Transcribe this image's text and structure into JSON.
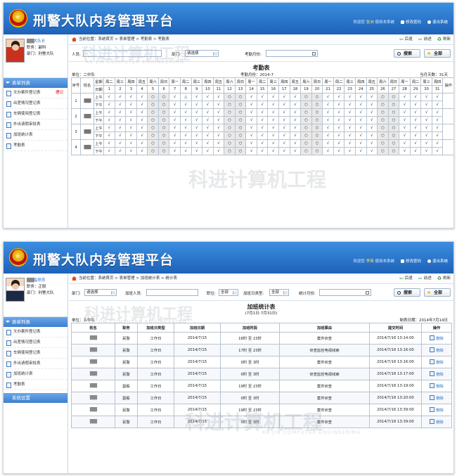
{
  "app": {
    "title": "刑警大队内务管理平台",
    "welcome_prefix": "欢迎您",
    "welcome_suffix": "使用本系统",
    "change_password": "修改密码",
    "logout": "退出系统"
  },
  "nav": {
    "back": "后退",
    "forward": "前进",
    "refresh": "刷新"
  },
  "sidebar": {
    "menu_header": "表单列表",
    "items": [
      "文办案件登记表",
      "出差情况登记表",
      "车辆使用登记表",
      "外出请假审批表",
      "加班统计表",
      "考勤表"
    ],
    "badge": "理记",
    "system_settings": "系统设置"
  },
  "screen1": {
    "user": {
      "name": "大队长",
      "post_label": "职务：",
      "post": "副科",
      "dept_label": "部门：",
      "dept": "刑警大队"
    },
    "welcome_name": "张洲",
    "breadcrumb": "当前位置：系统首页 > 表单管理 > 考勤表 > 考勤表",
    "filter": {
      "person_label": "人员:",
      "dept_label": "部门:",
      "dept_value": "请选择",
      "month_label": "考勤月份:"
    },
    "search_button": "搜索",
    "all_button": "全部",
    "table_title": "考勤表",
    "unit_label": "单位：二中队",
    "month_label": "考勤月份：2014-7",
    "days_label": "当月天数：31天",
    "header_seq": "序号",
    "header_name": "姓名",
    "header_week": "星期",
    "header_date": "日期",
    "header_op": "操作",
    "weekdays": [
      "周二",
      "周三",
      "周四",
      "周五",
      "周六",
      "周日",
      "周一",
      "周二",
      "周三",
      "周四",
      "周五",
      "周六",
      "周日",
      "周一",
      "周二",
      "周三",
      "周四",
      "周五",
      "周六",
      "周日",
      "周一",
      "周二",
      "周三",
      "周四",
      "周五",
      "周六",
      "周日",
      "周一",
      "周二",
      "周三",
      "周四"
    ],
    "dates": [
      "1",
      "2",
      "3",
      "4",
      "5",
      "6",
      "7",
      "8",
      "9",
      "10",
      "11",
      "12",
      "13",
      "14",
      "15",
      "16",
      "17",
      "18",
      "19",
      "20",
      "21",
      "22",
      "23",
      "24",
      "25",
      "26",
      "27",
      "28",
      "29",
      "30",
      "31"
    ],
    "am": "上午",
    "pm": "下午",
    "rows": [
      {
        "seq": "1",
        "name": "███",
        "am": [
          "√",
          "√",
          "√",
          "√",
          "○",
          "○",
          "√",
          "△",
          "√",
          "√",
          "√",
          "○",
          "○",
          "√",
          "√",
          "√",
          "√",
          "√",
          "○",
          "○",
          "√",
          "√",
          "√",
          "√",
          "√",
          "○",
          "○",
          "√",
          "√",
          "√",
          "√"
        ],
        "pm": [
          "√",
          "√",
          "√",
          "√",
          "○",
          "○",
          "√",
          "√",
          "√",
          "√",
          "√",
          "○",
          "○",
          "√",
          "√",
          "√",
          "√",
          "√",
          "○",
          "○",
          "√",
          "√",
          "√",
          "√",
          "√",
          "○",
          "○",
          "√",
          "√",
          "√",
          "√"
        ]
      },
      {
        "seq": "2",
        "name": "███",
        "am": [
          "√",
          "√",
          "√",
          "√",
          "○",
          "○",
          "√",
          "√",
          "√",
          "√",
          "√",
          "○",
          "○",
          "√",
          "√",
          "√",
          "√",
          "√",
          "○",
          "○",
          "√",
          "√",
          "√",
          "√",
          "√",
          "○",
          "○",
          "√",
          "√",
          "√",
          "√"
        ],
        "pm": [
          "√",
          "√",
          "√",
          "√",
          "○",
          "○",
          "√",
          "√",
          "√",
          "√",
          "√",
          "○",
          "○",
          "√",
          "√",
          "√",
          "√",
          "√",
          "○",
          "○",
          "√",
          "√",
          "√",
          "√",
          "√",
          "○",
          "○",
          "√",
          "√",
          "√",
          "√"
        ]
      },
      {
        "seq": "3",
        "name": "███",
        "am": [
          "√",
          "√",
          "√",
          "√",
          "○",
          "○",
          "√",
          "√",
          "√",
          "√",
          "√",
          "○",
          "○",
          "√",
          "√",
          "√",
          "√",
          "√",
          "○",
          "○",
          "√",
          "√",
          "√",
          "√",
          "√",
          "○",
          "○",
          "√",
          "√",
          "√",
          "√"
        ],
        "pm": [
          "√",
          "√",
          "√",
          "√",
          "○",
          "○",
          "√",
          "√",
          "√",
          "√",
          "√",
          "○",
          "○",
          "√",
          "√",
          "√",
          "√",
          "√",
          "○",
          "○",
          "√",
          "√",
          "√",
          "√",
          "√",
          "○",
          "○",
          "√",
          "√",
          "√",
          "√"
        ]
      },
      {
        "seq": "4",
        "name": "███",
        "am": [
          "√",
          "√",
          "√",
          "√",
          "○",
          "○",
          "√",
          "√",
          "√",
          "√",
          "√",
          "○",
          "○",
          "√",
          "√",
          "√",
          "√",
          "√",
          "○",
          "○",
          "√",
          "√",
          "√",
          "√",
          "√",
          "○",
          "○",
          "√",
          "√",
          "√",
          "√"
        ],
        "pm": [
          "√",
          "√",
          "√",
          "√",
          "○",
          "○",
          "√",
          "√",
          "√",
          "√",
          "√",
          "○",
          "○",
          "√",
          "√",
          "√",
          "√",
          "√",
          "○",
          "○",
          "√",
          "√",
          "√",
          "√",
          "√",
          "○",
          "○",
          "√",
          "√",
          "√",
          "√"
        ]
      }
    ]
  },
  "screen2": {
    "user": {
      "name": "指导员",
      "post_label": "职务：",
      "post": "正股",
      "dept_label": "部门：",
      "dept": "刑警大队"
    },
    "welcome_name": "李爽",
    "breadcrumb": "当前位置：系统首页 > 表单管理 > 加班统计表 > 统计表",
    "filter": {
      "dept_label": "部门:",
      "dept_value": "请选择",
      "person_label": "加班人员:",
      "post_label": "职位:",
      "post_value": "全部",
      "type_label": "加班日类型:",
      "type_value": "全部",
      "month_label": "统计月份:"
    },
    "search_button": "搜索",
    "all_button": "全部",
    "table_title": "加班统计表",
    "date_range": "(7月1日-7月31日)",
    "unit_label": "单位：五中队",
    "make_date": "制表日期：2014年7月14日",
    "headers": [
      "姓名",
      "职务",
      "加班日类型",
      "加班日期",
      "加班时段",
      "加班事由",
      "提交时间",
      "操作"
    ],
    "delete_label": "删除",
    "rows": [
      {
        "name": "███",
        "post": "民警",
        "type": "工作日",
        "date": "2014/7/15",
        "period": "18时 至 23时",
        "reason": "案件侦查",
        "submit": "2014/7/16 13:14:00"
      },
      {
        "name": "███",
        "post": "民警",
        "type": "工作日",
        "date": "2014/7/15",
        "period": "17时 至 23时",
        "reason": "侦查监控电视线索",
        "submit": "2014/7/16 13:16:00"
      },
      {
        "name": "███",
        "post": "民警",
        "type": "工作日",
        "date": "2014/7/15",
        "period": "0时 至 3时",
        "reason": "案件侦查",
        "submit": "2014/7/16 13:16:00"
      },
      {
        "name": "███",
        "post": "民警",
        "type": "工作日",
        "date": "2014/7/15",
        "period": "0时 至 3时",
        "reason": "侦查监控电视线索",
        "submit": "2014/7/16 13:17:00"
      },
      {
        "name": "███",
        "post": "副股",
        "type": "工作日",
        "date": "2014/7/15",
        "period": "19时 至 23时",
        "reason": "案件侦查",
        "submit": "2014/7/16 13:19:00"
      },
      {
        "name": "███",
        "post": "副股",
        "type": "工作日",
        "date": "2014/7/15",
        "period": "0时 至 3时",
        "reason": "案件侦查",
        "submit": "2014/7/16 13:20:00"
      },
      {
        "name": "███",
        "post": "民警",
        "type": "工作日",
        "date": "2014/7/15",
        "period": "19时 至 23时",
        "reason": "案件侦查",
        "submit": "2014/7/16 13:39:00"
      },
      {
        "name": "███",
        "post": "民警",
        "type": "工作日",
        "date": "2014/7/15",
        "period": "0时 至 3时",
        "reason": "案件侦查",
        "submit": "2014/7/16 13:39:00"
      }
    ]
  },
  "watermark": {
    "cn": "科进计算机工程",
    "en": "KE JIN COMPUTER ENGINEERING"
  },
  "colors": {
    "header_top": "#3c8fe0",
    "header_bottom": "#1d62b8",
    "menu_head": "#3c7fcf",
    "accent_yellow": "#ffe34d",
    "weekend_cell": "#e9e9e9"
  }
}
